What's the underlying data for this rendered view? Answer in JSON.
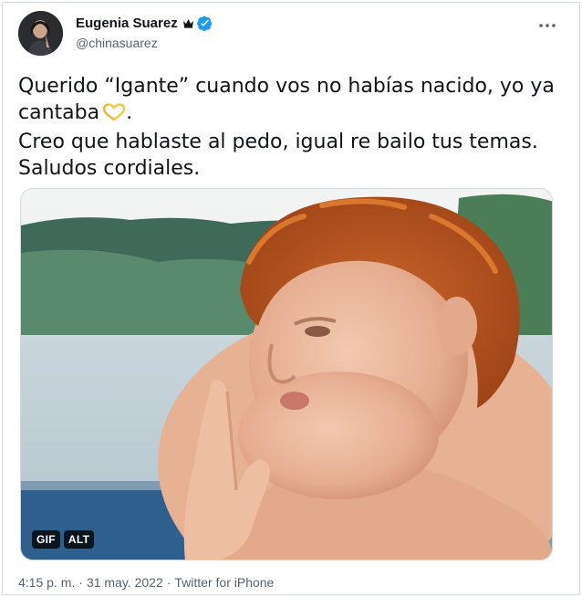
{
  "user": {
    "display_name": "Eugenia Suarez",
    "handle": "@chinasuarez",
    "verified": true,
    "icons": [
      "crown-icon",
      "verified-badge-icon"
    ]
  },
  "tweet": {
    "lines": [
      "Querido “Igante” cuando vos no habías nacido, yo ya",
      "cantaba",
      "Creo que hablaste al pedo, igual re bailo tus temas.",
      "Saludos cordiales."
    ],
    "heart_emoji": "yellow-heart-hands-icon",
    "line2_suffix": "."
  },
  "media": {
    "badge_gif": "GIF",
    "badge_alt": "ALT"
  },
  "footer": {
    "time": "4:15 p. m.",
    "sep1": "·",
    "date": "31 may. 2022",
    "sep2": "·",
    "source": "Twitter for iPhone"
  },
  "colors": {
    "verified_blue": "#1d9bf0",
    "text_primary": "#0f1419",
    "text_secondary": "#536471",
    "border": "#cfd9de"
  }
}
